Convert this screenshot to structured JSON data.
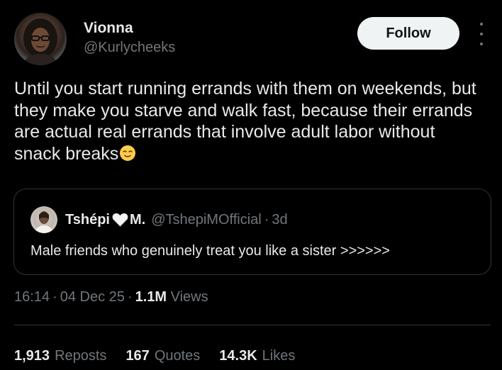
{
  "author": {
    "name": "Vionna",
    "handle": "@Kurlycheeks"
  },
  "follow_label": "Follow",
  "tweet": {
    "text": "Until you start running errands with them on weekends, but they make you starve and walk fast, because their errands are actual real errands that involve adult labor without snack breaks",
    "trailing_emoji": "relieved-face-emoji"
  },
  "quote": {
    "name_part1": "Tshépi",
    "name_part2": "M.",
    "name_emoji": "white-heart-emoji",
    "handle": "@TshepiMOfficial",
    "dot": "·",
    "time": "3d",
    "text": "Male friends who genuinely treat you like a sister >>>>>>"
  },
  "meta": {
    "time": "16:14",
    "date": "04 Dec 25",
    "sep": "·",
    "views_count": "1.1M",
    "views_label": "Views"
  },
  "stats": {
    "reposts_count": "1,913",
    "reposts_label": "Reposts",
    "quotes_count": "167",
    "quotes_label": "Quotes",
    "likes_count": "14.3K",
    "likes_label": "Likes"
  },
  "colors": {
    "background": "#000000",
    "primary_text": "#e7e9ea",
    "secondary_text": "#71767b",
    "border": "#2f3336",
    "follow_bg": "#eff3f4"
  }
}
